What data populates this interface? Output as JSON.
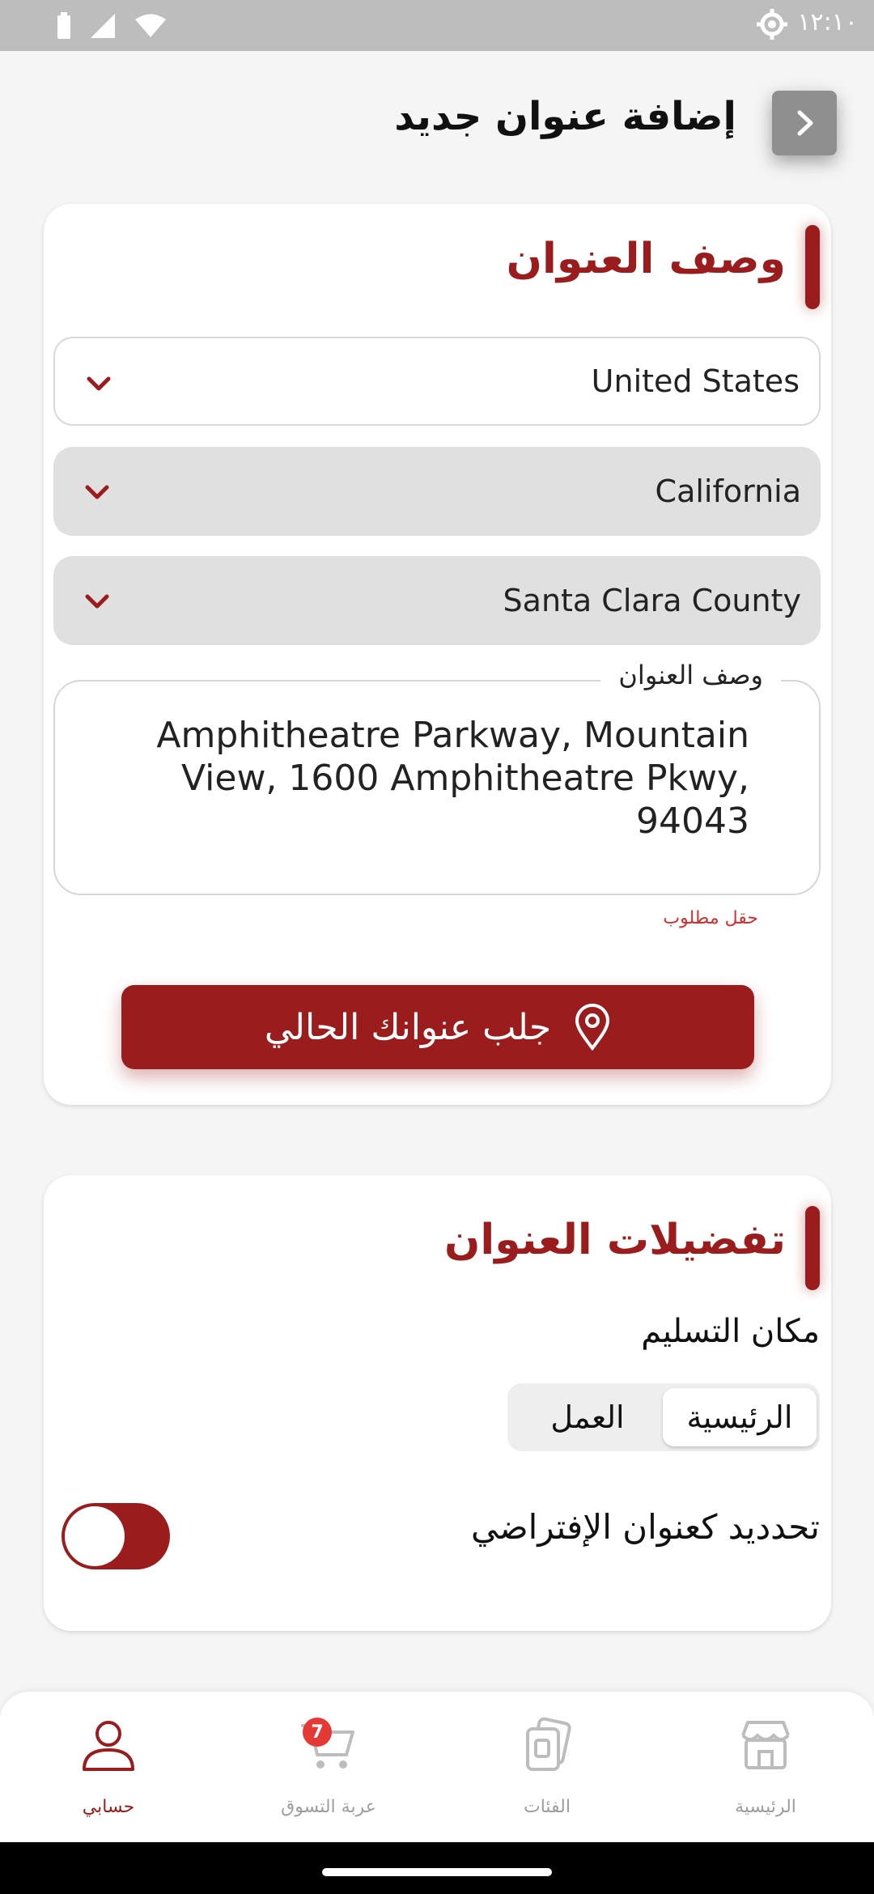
{
  "status_bar": {
    "time": "١٢:١٠"
  },
  "header": {
    "title": "إضافة عنوان جديد"
  },
  "address_description": {
    "section_title": "وصف العنوان",
    "country": "United States",
    "state": "California",
    "county": "Santa Clara County",
    "field_label": "وصف العنوان",
    "field_value": "Amphitheatre Parkway, Mountain View, 1600 Amphitheatre Pkwy, 94043",
    "helper_text": "حقل مطلوب",
    "locate_button": "جلب عنوانك الحالي"
  },
  "address_details": {
    "section_title": "تفضيلات العنوان",
    "delivery_place_label": "مكان التسليم",
    "options": {
      "home": "الرئيسية",
      "work": "العمل"
    },
    "selected_option": "home",
    "default_toggle_label": "تحدديد كعنوان الإفتراضي"
  },
  "bottom_nav": {
    "home": "الرئيسية",
    "categories": "الفئات",
    "cart": "عربة التسوق",
    "cart_badge": "7",
    "account": "حسابي"
  },
  "colors": {
    "accent": "#9b1c1c",
    "error": "#d32f2f",
    "badge": "#e53935"
  },
  "icons": [
    "settings-icon",
    "chevron-right-icon",
    "chevron-down-icon",
    "location-pin-icon",
    "store-icon",
    "categories-icon",
    "cart-icon",
    "user-icon"
  ]
}
